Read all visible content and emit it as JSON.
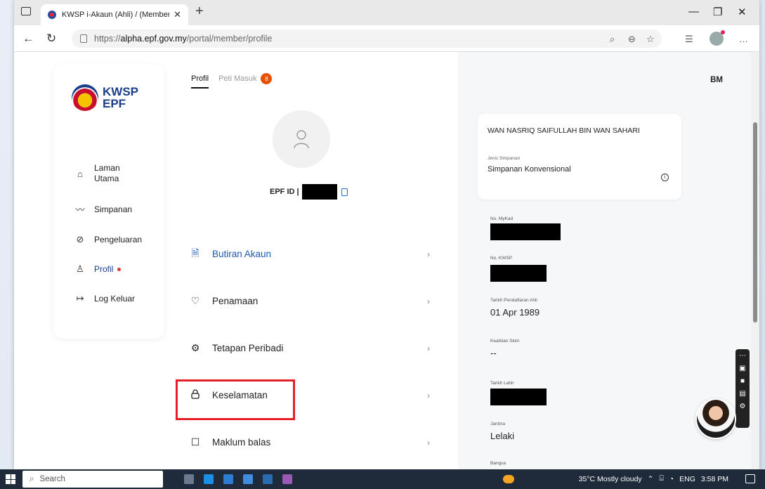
{
  "browser": {
    "tab_title": "KWSP i-Akaun (Ahli) / (Member)",
    "url_prefix": "https://",
    "url_host": "alpha.epf.gov.my",
    "url_path": "/portal/member/profile"
  },
  "sidebar": {
    "logo_line1": "KWSP",
    "logo_line2": "EPF",
    "items": [
      {
        "label": "Laman Utama",
        "icon": "home-icon"
      },
      {
        "label": "Simpanan",
        "icon": "trend-icon"
      },
      {
        "label": "Pengeluaran",
        "icon": "leaf-icon"
      },
      {
        "label": "Profil",
        "icon": "user-icon"
      },
      {
        "label": "Log Keluar",
        "icon": "logout-icon"
      }
    ]
  },
  "center": {
    "tab_profil": "Profil",
    "tab_peti": "Peti Masuk",
    "inbox_badge": "8",
    "epf_id_label": "EPF ID |",
    "menu": [
      {
        "label": "Butiran Akaun",
        "icon": "document-icon"
      },
      {
        "label": "Penamaan",
        "icon": "heart-icon"
      },
      {
        "label": "Tetapan Peribadi",
        "icon": "settings-person-icon"
      },
      {
        "label": "Keselamatan",
        "icon": "lock-icon"
      },
      {
        "label": "Maklum balas",
        "icon": "feedback-icon"
      }
    ],
    "chevron": "›"
  },
  "right": {
    "lang": "BM",
    "name": "WAN NASRIQ SAIFULLAH BIN WAN SAHARI",
    "jenis_label": "Jenis Simpanan",
    "jenis_value": "Simpanan Konvensional",
    "fields": [
      {
        "label": "No. MyKad",
        "value": ""
      },
      {
        "label": "No. KWSP",
        "value": ""
      },
      {
        "label": "Tarikh Pendaftaran Ahli",
        "value": "01 Apr 1989"
      },
      {
        "label": "Keahlian Skim",
        "value": "--"
      },
      {
        "label": "Tarikh Lahir",
        "value": ""
      },
      {
        "label": "Jantina",
        "value": "Lelaki"
      },
      {
        "label": "Bangsa",
        "value": ""
      }
    ]
  },
  "taskbar": {
    "search": "Search",
    "weather": "35°C  Mostly cloudy",
    "lang": "ENG",
    "time": "3:58 PM"
  }
}
